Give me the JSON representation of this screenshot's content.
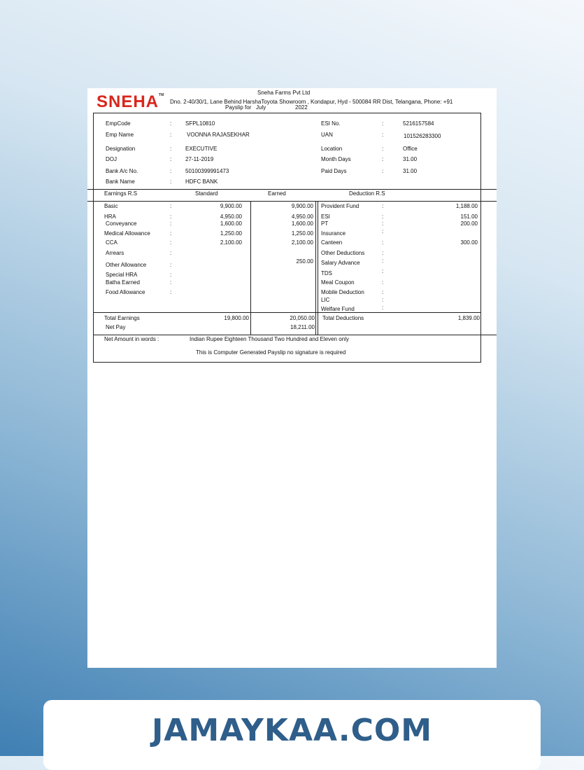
{
  "company": {
    "name": "Sneha Farms Pvt Ltd",
    "logo_text": "SNEHA",
    "logo_tm": "TM",
    "address": "Dno. 2-40/30/1, Lane Behind HarshaToyota Showroom , Kondapur, Hyd - 500084 RR Dist, Telangana, Phone: +91",
    "payslip_for_label": "Payslip for",
    "month": "July",
    "year": "2022"
  },
  "employee_left": [
    {
      "label": "EmpCode",
      "sep": ":",
      "value": "SFPL10810"
    },
    {
      "label": "Emp Name",
      "sep": ":",
      "value": "VOONNA RAJASEKHAR"
    },
    {
      "label": "Designation",
      "sep": ":",
      "value": "EXECUTIVE"
    },
    {
      "label": "DOJ",
      "sep": ":",
      "value": "27-11-2019"
    },
    {
      "label": "Bank A/c No.",
      "sep": ":",
      "value": "50100399991473"
    },
    {
      "label": "Bank Name",
      "sep": ":",
      "value": "HDFC BANK"
    }
  ],
  "employee_right": [
    {
      "label": "ESI No.",
      "sep": ":",
      "value": "5216157584"
    },
    {
      "label": "UAN",
      "sep": ":",
      "value": "101526283300"
    },
    {
      "label": "Location",
      "sep": ":",
      "value": "Office"
    },
    {
      "label": "Month Days",
      "sep": ":",
      "value": "31.00"
    },
    {
      "label": "Paid Days",
      "sep": ":",
      "value": "31.00"
    }
  ],
  "headers": {
    "earnings": "Earnings R.S",
    "standard": "Standard",
    "earned": "Earned",
    "deductions": "Deduction R.S"
  },
  "earnings": [
    {
      "label": "Basic",
      "sep": ":",
      "standard": "9,900.00",
      "earned": "9,900.00"
    },
    {
      "label": "HRA",
      "sep": ":",
      "standard": "4,950.00",
      "earned": "4,950.00"
    },
    {
      "label": "Conveyance",
      "sep": ":",
      "standard": "1,600.00",
      "earned": "1,600.00"
    },
    {
      "label": "Medical Allowance",
      "sep": ":",
      "standard": "1,250.00",
      "earned": "1,250.00"
    },
    {
      "label": "CCA",
      "sep": ":",
      "standard": "2,100.00",
      "earned": "2,100.00"
    },
    {
      "label": "Arrears",
      "sep": ":",
      "standard": "",
      "earned": ""
    },
    {
      "label": "Other Allowance",
      "sep": ":",
      "standard": "",
      "earned": "250.00"
    },
    {
      "label": "Special HRA",
      "sep": ":",
      "standard": "",
      "earned": ""
    },
    {
      "label": "Batha Earned",
      "sep": ":",
      "standard": "",
      "earned": ""
    },
    {
      "label": "Food Allowance",
      "sep": ":",
      "standard": "",
      "earned": ""
    }
  ],
  "deductions": [
    {
      "label": "Provident Fund",
      "sep": ":",
      "value": "1,188.00"
    },
    {
      "label": "ESI",
      "sep": ":",
      "value": "151.00"
    },
    {
      "label": "PT",
      "sep": ":",
      "value": "200.00"
    },
    {
      "label": "Insurance",
      "sep": ":",
      "value": ""
    },
    {
      "label": "Canteen",
      "sep": ":",
      "value": "300.00"
    },
    {
      "label": "Other Deductions",
      "sep": ":",
      "value": ""
    },
    {
      "label": "Salary Advance",
      "sep": ":",
      "value": ""
    },
    {
      "label": "TDS",
      "sep": ":",
      "value": ""
    },
    {
      "label": "Meal Coupon",
      "sep": ":",
      "value": ""
    },
    {
      "label": "Mobile Deduction",
      "sep": ":",
      "value": ""
    },
    {
      "label": "LIC",
      "sep": ":",
      "value": ""
    },
    {
      "label": "Welfare Fund",
      "sep": ":",
      "value": ""
    }
  ],
  "totals": {
    "total_earnings_label": "Total Earnings",
    "total_standard": "19,800.00",
    "total_earned": "20,050.00",
    "total_deductions_label": "Total Deductions",
    "total_deductions": "1,839.00",
    "net_pay_label": "Net Pay",
    "net_pay": "18,211.00"
  },
  "net_words": {
    "label": "Net Amount in words :",
    "value": "Indian Rupee Eighteen Thousand Two Hundred  and Eleven  only"
  },
  "footer_note": "This is Computer Generated Payslip no signature is required",
  "watermark": "JAMAYKAA.COM"
}
